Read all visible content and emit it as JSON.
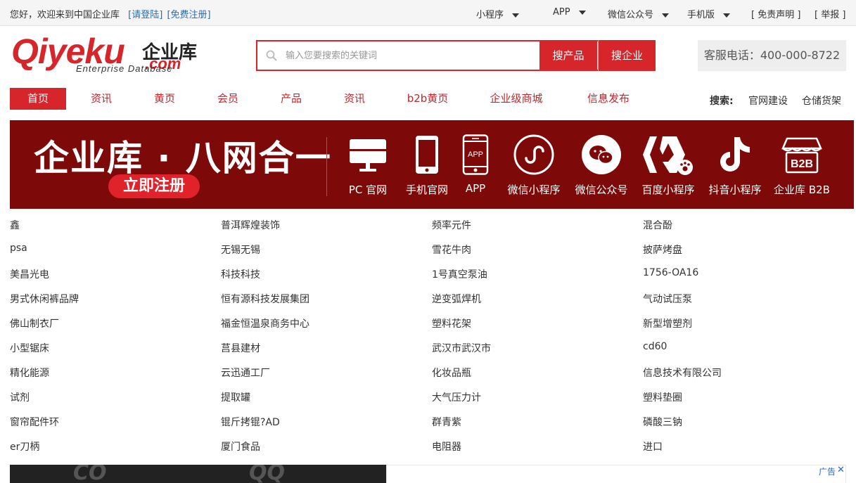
{
  "topbar": {
    "welcome": "您好，欢迎来到中国企业库",
    "login": "[请登陆]",
    "register": "[免费注册]",
    "miniprogram": "小程序",
    "app": "APP",
    "wechat": "微信公众号",
    "mobile": "手机版",
    "disclaimer": "[ 免责声明 ]",
    "report": "[ 举报 ]"
  },
  "logo": {
    "text": "Qiyeku",
    "cn": "企业库",
    "com": ".com",
    "sub": "Enterprise Database"
  },
  "search": {
    "placeholder": "输入您要搜索的关键词",
    "btn_product": "搜产品",
    "btn_company": "搜企业"
  },
  "phone": "客服电话：400-000-8722",
  "nav": {
    "items": [
      "首页",
      "资讯",
      "黄页",
      "会员",
      "产品",
      "资讯",
      "b2b黄页",
      "企业级商城",
      "信息发布"
    ],
    "search_label": "搜索:",
    "right_links": [
      "官网建设",
      "仓储货架"
    ]
  },
  "banner": {
    "headline": "企业库 · 八网合一",
    "register": "立即注册",
    "icons": [
      {
        "label": "PC 官网",
        "icon": "monitor-icon"
      },
      {
        "label": "手机官网",
        "icon": "phone-icon"
      },
      {
        "label": "APP",
        "icon": "app-icon"
      },
      {
        "label": "微信小程序",
        "icon": "miniprogram-icon"
      },
      {
        "label": "微信公众号",
        "icon": "wechat-icon"
      },
      {
        "label": "百度小程序",
        "icon": "baidu-icon"
      },
      {
        "label": "抖音小程序",
        "icon": "douyin-icon"
      },
      {
        "label": "企业库 B2B",
        "icon": "b2b-icon"
      }
    ]
  },
  "keywords": [
    [
      "鑫",
      "普洱辉煌装饰",
      "频率元件",
      "混合酚"
    ],
    [
      "psa",
      "无锡无锡",
      "雪花牛肉",
      "披萨烤盘"
    ],
    [
      "美昌光电",
      "科技科技",
      "1号真空泵油",
      "1756-OA16"
    ],
    [
      "男式休闲裤品牌",
      "恒有源科技发展集团",
      "逆变弧焊机",
      "气动试压泵"
    ],
    [
      "佛山制衣厂",
      "福金恒温泉商务中心",
      "塑料花架",
      "新型增塑剂"
    ],
    [
      "小型锯床",
      "莒县建材",
      "武汉市武汉市",
      "cd60"
    ],
    [
      "精化能源",
      "云迅通工厂",
      "化妆品瓶",
      "信息技术有限公司"
    ],
    [
      "试剂",
      "提取罐",
      "大气压力计",
      "塑料垫圈"
    ],
    [
      "窗帘配件环",
      "锟斤拷锟?AD",
      "群青紫",
      "磷酸三钠"
    ],
    [
      "er刀柄",
      "厦门食品",
      "电阻器",
      "进口"
    ]
  ],
  "ad": {
    "tag": "广告",
    "close": "✕"
  },
  "colors": {
    "brand_red": "#d7262b",
    "banner_bg": "#7d0909",
    "link_blue": "#2a6bb5"
  }
}
